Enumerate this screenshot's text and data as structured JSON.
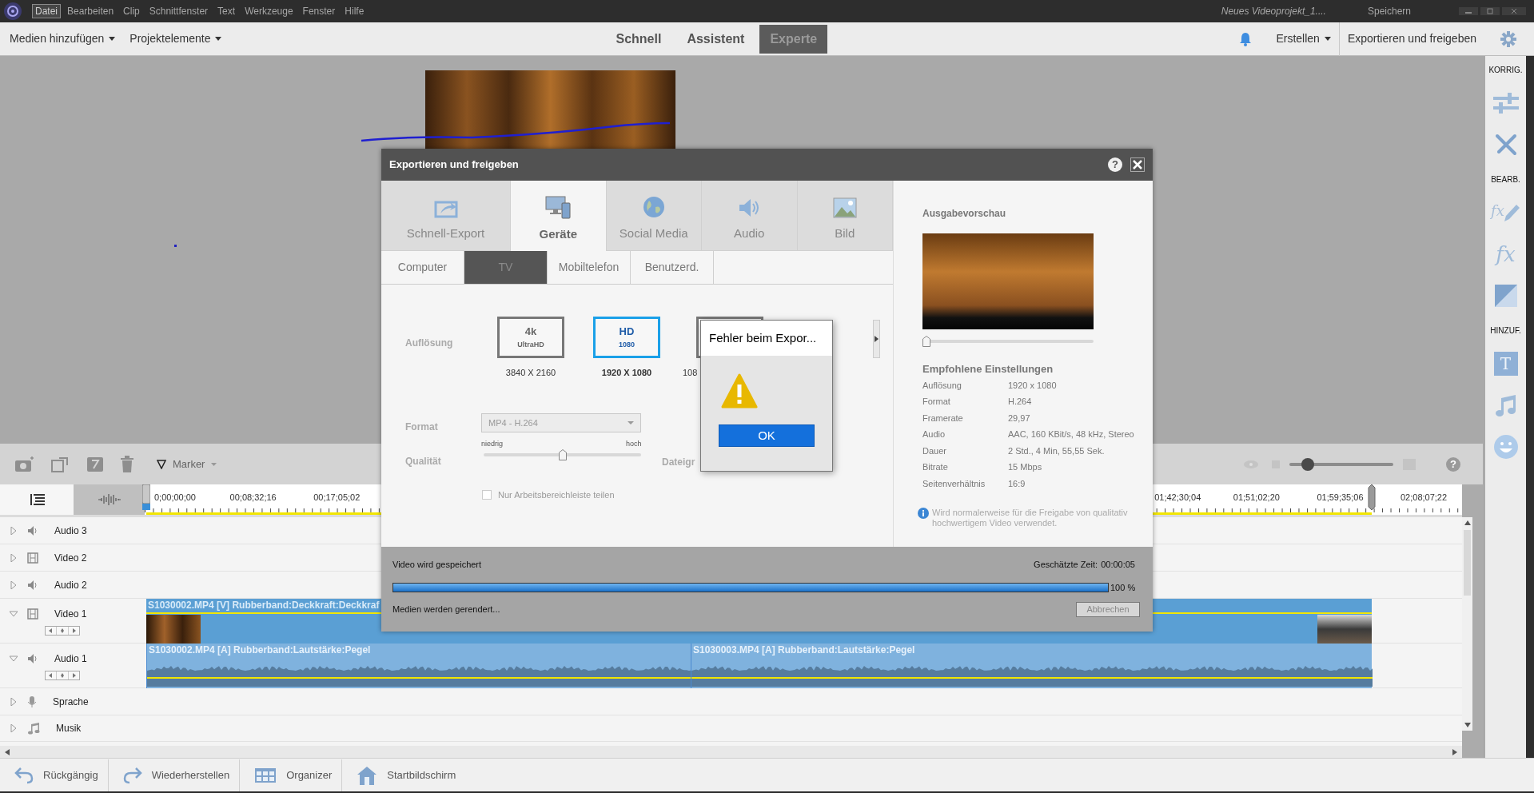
{
  "menu_bar": {
    "items": [
      {
        "label": "Datei",
        "selected": true
      },
      {
        "label": "Bearbeiten",
        "selected": false
      },
      {
        "label": "Clip",
        "selected": false
      },
      {
        "label": "Schnittfenster",
        "selected": false
      },
      {
        "label": "Text",
        "selected": false
      },
      {
        "label": "Werkzeuge",
        "selected": false
      },
      {
        "label": "Fenster",
        "selected": false
      },
      {
        "label": "Hilfe",
        "selected": false
      }
    ],
    "project_title": "Neues Videoprojekt_1....",
    "save": "Speichern"
  },
  "toolbar": {
    "dropdowns": [
      "Medien hinzufügen",
      "Projektelemente"
    ],
    "modes": [
      {
        "label": "Schnell",
        "selected": false
      },
      {
        "label": "Assistent",
        "selected": false
      },
      {
        "label": "Experte",
        "selected": true
      }
    ],
    "create": "Erstellen",
    "export": "Exportieren und freigeben"
  },
  "side_panel": {
    "sections": [
      {
        "heading": "KORRIG.",
        "tools": [
          {
            "kind": "adjust"
          },
          {
            "kind": "tools"
          }
        ]
      },
      {
        "heading": "BEARB.",
        "tools": [
          {
            "kind": "fx-edit",
            "glyph": "fx"
          },
          {
            "kind": "fx",
            "glyph": "fx"
          },
          {
            "kind": "transition"
          }
        ]
      },
      {
        "heading": "HINZUF.",
        "tools": [
          {
            "kind": "title",
            "glyph": "T"
          },
          {
            "kind": "music"
          },
          {
            "kind": "smiley"
          }
        ]
      }
    ]
  },
  "timeline": {
    "marker": "Marker",
    "zoom": {
      "level": 0.13
    },
    "help": "?",
    "ruler": [
      "0;00;00;00",
      "00;08;32;16",
      "00;17;05;02",
      "01;42;30;04",
      "01;51;02;20",
      "01;59;35;06",
      "02;08;07;22"
    ],
    "tracks": [
      {
        "name": "Audio 3",
        "kind": "audio",
        "expanded": false
      },
      {
        "name": "Video 2",
        "kind": "video",
        "expanded": false
      },
      {
        "name": "Audio 2",
        "kind": "audio",
        "expanded": false
      },
      {
        "name": "Video 1",
        "kind": "video",
        "expanded": true,
        "clips": [
          {
            "label": "S1030002.MP4 [V]  Rubberband:Deckkraft:Deckkraf"
          }
        ]
      },
      {
        "name": "Audio 1",
        "kind": "audio",
        "expanded": true,
        "clips": [
          {
            "label": "S1030002.MP4 [A]  Rubberband:Lautstärke:Pegel"
          },
          {
            "label": "S1030003.MP4 [A]  Rubberband:Lautstärke:Pegel"
          }
        ]
      },
      {
        "name": "Sprache",
        "kind": "voice",
        "expanded": false
      },
      {
        "name": "Musik",
        "kind": "music",
        "expanded": false
      }
    ]
  },
  "bottom_bar": [
    {
      "label": "Rückgängig",
      "kind": "undo"
    },
    {
      "label": "Wiederherstellen",
      "kind": "redo"
    },
    {
      "label": "Organizer",
      "kind": "organizer"
    },
    {
      "label": "Startbildschirm",
      "kind": "home"
    }
  ],
  "export_dialog": {
    "title": "Exportieren und freigeben",
    "help": "?",
    "categories": [
      {
        "label": "Schnell-Export",
        "kind": "quick",
        "selected": false
      },
      {
        "label": "Geräte",
        "kind": "devices",
        "selected": true
      },
      {
        "label": "Social Media",
        "kind": "globe",
        "selected": false
      },
      {
        "label": "Audio",
        "kind": "audio",
        "selected": false
      },
      {
        "label": "Bild",
        "kind": "image",
        "selected": false
      }
    ],
    "subtabs": [
      {
        "label": "Computer",
        "selected": false
      },
      {
        "label": "TV",
        "selected": true
      },
      {
        "label": "Mobiltelefon",
        "selected": false
      },
      {
        "label": "Benutzerd.",
        "selected": false
      }
    ],
    "resolution": {
      "label": "Auflösung",
      "options": [
        {
          "badge": "4k",
          "sub": "UltraHD",
          "size": "3840 X 2160",
          "selected": false
        },
        {
          "badge": "HD",
          "sub": "1080",
          "size": "1920 X 1080",
          "selected": true
        },
        {
          "size": "108",
          "selected": false
        }
      ]
    },
    "format": {
      "label": "Format",
      "value": "MP4 - H.264"
    },
    "quality": {
      "label": "Qualität",
      "low": "niedrig",
      "high": "hoch",
      "level": 0.5
    },
    "file_size_label": "Dateigr",
    "work_area_only": {
      "label": "Nur Arbeitsbereichleiste teilen",
      "checked": false
    },
    "preview": {
      "heading": "Ausgabevorschau",
      "level": 0
    },
    "recommended": {
      "heading": "Empfohlene Einstellungen",
      "rows": [
        {
          "name": "Auflösung",
          "value": "1920 x 1080"
        },
        {
          "name": "Format",
          "value": "H.264"
        },
        {
          "name": "Framerate",
          "value": "29,97"
        },
        {
          "name": "Audio",
          "value": "AAC, 160 KBit/s, 48 kHz, Stereo"
        },
        {
          "name": "Dauer",
          "value": "2 Std., 4 Min, 55,55 Sek."
        },
        {
          "name": "Bitrate",
          "value": "15 Mbps"
        },
        {
          "name": "Seitenverhältnis",
          "value": "16:9"
        }
      ],
      "note": "Wird normalerweise für die Freigabe von qualitativ hochwertigem Video verwendet."
    },
    "progress": {
      "status": "Video wird gespeichert",
      "time_label": "Geschätzte Zeit:",
      "time": "00:00:05",
      "level": 1,
      "percent": "100 %",
      "detail": "Medien werden gerendert...",
      "cancel": "Abbrechen"
    }
  },
  "error_dialog": {
    "title": "Fehler beim Expor...",
    "ok": "OK"
  }
}
